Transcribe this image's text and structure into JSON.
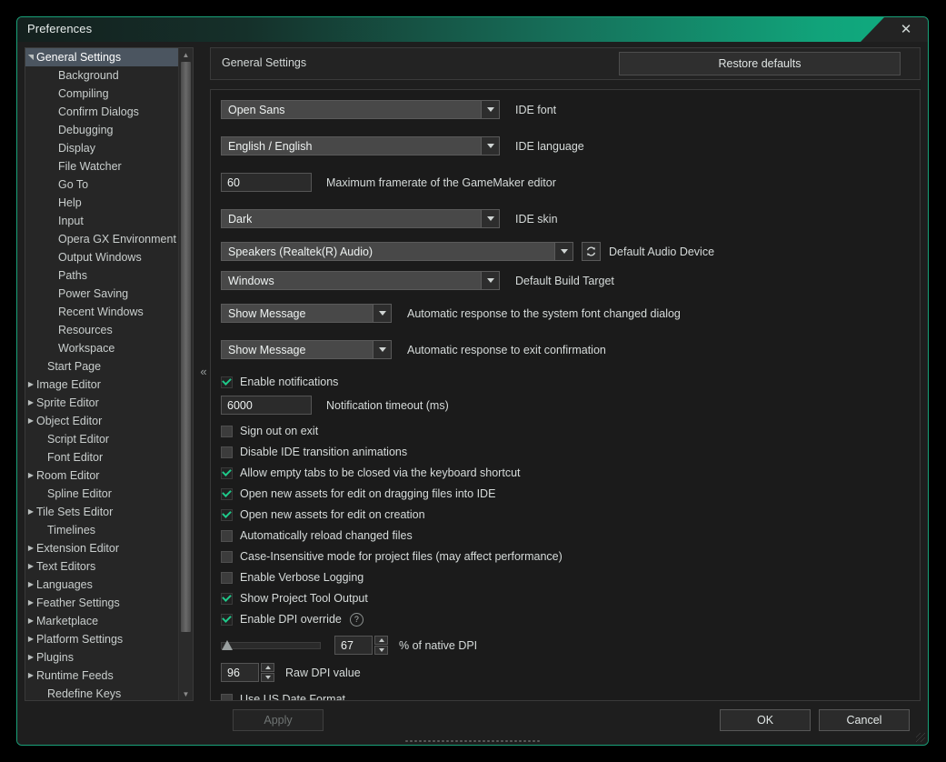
{
  "window": {
    "title": "Preferences",
    "close_icon": "✕"
  },
  "sidebar": {
    "items": [
      {
        "label": "General Settings",
        "level": 0,
        "arrow": "down",
        "selected": true
      },
      {
        "label": "Background",
        "level": 1,
        "arrow": "none",
        "selected": false
      },
      {
        "label": "Compiling",
        "level": 1,
        "arrow": "none",
        "selected": false
      },
      {
        "label": "Confirm Dialogs",
        "level": 1,
        "arrow": "none",
        "selected": false
      },
      {
        "label": "Debugging",
        "level": 1,
        "arrow": "none",
        "selected": false
      },
      {
        "label": "Display",
        "level": 1,
        "arrow": "none",
        "selected": false
      },
      {
        "label": "File Watcher",
        "level": 1,
        "arrow": "none",
        "selected": false
      },
      {
        "label": "Go To",
        "level": 1,
        "arrow": "none",
        "selected": false
      },
      {
        "label": "Help",
        "level": 1,
        "arrow": "none",
        "selected": false
      },
      {
        "label": "Input",
        "level": 1,
        "arrow": "none",
        "selected": false
      },
      {
        "label": "Opera GX Environment",
        "level": 1,
        "arrow": "none",
        "selected": false
      },
      {
        "label": "Output Windows",
        "level": 1,
        "arrow": "none",
        "selected": false
      },
      {
        "label": "Paths",
        "level": 1,
        "arrow": "none",
        "selected": false
      },
      {
        "label": "Power Saving",
        "level": 1,
        "arrow": "none",
        "selected": false
      },
      {
        "label": "Recent Windows",
        "level": 1,
        "arrow": "none",
        "selected": false
      },
      {
        "label": "Resources",
        "level": 1,
        "arrow": "none",
        "selected": false
      },
      {
        "label": "Workspace",
        "level": 1,
        "arrow": "none",
        "selected": false
      },
      {
        "label": "Start Page",
        "level": 0,
        "arrow": "none",
        "selected": false
      },
      {
        "label": "Image Editor",
        "level": 0,
        "arrow": "right",
        "selected": false
      },
      {
        "label": "Sprite Editor",
        "level": 0,
        "arrow": "right",
        "selected": false
      },
      {
        "label": "Object Editor",
        "level": 0,
        "arrow": "right",
        "selected": false
      },
      {
        "label": "Script Editor",
        "level": 0,
        "arrow": "none",
        "selected": false
      },
      {
        "label": "Font Editor",
        "level": 0,
        "arrow": "none",
        "selected": false
      },
      {
        "label": "Room Editor",
        "level": 0,
        "arrow": "right",
        "selected": false
      },
      {
        "label": "Spline Editor",
        "level": 0,
        "arrow": "none",
        "selected": false
      },
      {
        "label": "Tile Sets Editor",
        "level": 0,
        "arrow": "right",
        "selected": false
      },
      {
        "label": "Timelines",
        "level": 0,
        "arrow": "none",
        "selected": false
      },
      {
        "label": "Extension Editor",
        "level": 0,
        "arrow": "right",
        "selected": false
      },
      {
        "label": "Text Editors",
        "level": 0,
        "arrow": "right",
        "selected": false
      },
      {
        "label": "Languages",
        "level": 0,
        "arrow": "right",
        "selected": false
      },
      {
        "label": "Feather Settings",
        "level": 0,
        "arrow": "right",
        "selected": false
      },
      {
        "label": "Marketplace",
        "level": 0,
        "arrow": "right",
        "selected": false
      },
      {
        "label": "Platform Settings",
        "level": 0,
        "arrow": "right",
        "selected": false
      },
      {
        "label": "Plugins",
        "level": 0,
        "arrow": "right",
        "selected": false
      },
      {
        "label": "Runtime Feeds",
        "level": 0,
        "arrow": "right",
        "selected": false
      },
      {
        "label": "Redefine Keys",
        "level": 0,
        "arrow": "none",
        "selected": false
      }
    ],
    "collapse_handle": "«"
  },
  "header": {
    "title": "General Settings",
    "restore_defaults": "Restore defaults"
  },
  "settings": {
    "ide_font": {
      "value": "Open Sans",
      "label": "IDE font"
    },
    "ide_language": {
      "value": "English / English",
      "label": "IDE language"
    },
    "max_framerate": {
      "value": "60",
      "label": "Maximum framerate of the GameMaker editor"
    },
    "ide_skin": {
      "value": "Dark",
      "label": "IDE skin"
    },
    "audio_device": {
      "value": "Speakers (Realtek(R) Audio)",
      "label": "Default Audio Device",
      "refresh_icon": "refresh-icon"
    },
    "build_target": {
      "value": "Windows",
      "label": "Default Build Target"
    },
    "font_changed_response": {
      "value": "Show Message",
      "label": "Automatic response to the system font changed dialog"
    },
    "exit_confirm_response": {
      "value": "Show Message",
      "label": "Automatic response to exit confirmation"
    },
    "enable_notifications": {
      "label": "Enable notifications",
      "checked": true
    },
    "notification_timeout": {
      "value": "6000",
      "label": "Notification timeout (ms)"
    },
    "checkboxes": [
      {
        "label": "Sign out on exit",
        "checked": false,
        "name": "sign-out-on-exit"
      },
      {
        "label": "Disable IDE transition animations",
        "checked": false,
        "name": "disable-ide-transition-animations"
      },
      {
        "label": "Allow empty tabs to be closed via the keyboard shortcut",
        "checked": true,
        "name": "allow-empty-tabs-closed"
      },
      {
        "label": "Open new assets for edit on dragging files into IDE",
        "checked": true,
        "name": "open-assets-on-drag"
      },
      {
        "label": "Open new assets for edit on creation",
        "checked": true,
        "name": "open-assets-on-creation"
      },
      {
        "label": "Automatically reload changed files",
        "checked": false,
        "name": "auto-reload-changed-files"
      },
      {
        "label": "Case-Insensitive mode for project files (may affect performance)",
        "checked": false,
        "name": "case-insensitive-mode"
      },
      {
        "label": "Enable Verbose Logging",
        "checked": false,
        "name": "enable-verbose-logging"
      },
      {
        "label": "Show Project Tool Output",
        "checked": true,
        "name": "show-project-tool-output"
      }
    ],
    "enable_dpi_override": {
      "label": "Enable DPI override",
      "checked": true,
      "help_icon": "?"
    },
    "dpi_percent": {
      "value": "67",
      "label": "% of native DPI",
      "slider_percent": 67
    },
    "raw_dpi": {
      "value": "96",
      "label": "Raw DPI value"
    },
    "us_date_format": {
      "label": "Use US Date Format",
      "checked": false
    }
  },
  "footer": {
    "apply": "Apply",
    "ok": "OK",
    "cancel": "Cancel"
  },
  "colors": {
    "accent": "#0fae81",
    "check": "#1fc98a",
    "selection": "#4b5560"
  }
}
